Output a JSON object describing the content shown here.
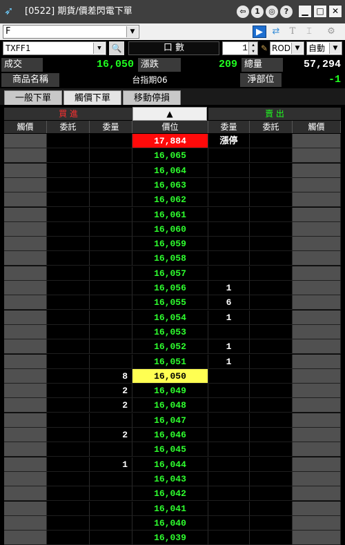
{
  "window": {
    "title": "[0522] 期貨/價差閃電下單",
    "buttons": [
      "⇦",
      "1",
      "◎",
      "?"
    ]
  },
  "toolbar": {
    "account_value": "F",
    "icons": [
      "arrow-right-icon",
      "refresh-icon",
      "font-icon",
      "bracket-icon",
      "gear-icon"
    ]
  },
  "order": {
    "symbol": "TXFF1",
    "lots_label": "口 數",
    "quantity": "1",
    "time_in_force": "ROD",
    "mode": "自動"
  },
  "quote": {
    "last_label": "成交",
    "last_value": "16,050",
    "change_label": "漲跌",
    "change_value": "209",
    "volume_label": "總量",
    "volume_value": "57,294"
  },
  "product": {
    "name_label": "商品名稱",
    "name_value": "台指期06",
    "net_label": "淨部位",
    "net_value": "-1"
  },
  "tabs": [
    "一般下單",
    "觸價下單",
    "移動停損"
  ],
  "ladder": {
    "buy_label": "買 進",
    "sell_label": "賣 出",
    "center_symbol": "▲",
    "columns": [
      "觸價",
      "委託",
      "委量",
      "價位",
      "委量",
      "委託",
      "觸價"
    ],
    "colors": {
      "buy": "#ff3030",
      "sell": "#20ff20",
      "price": "#2eff2e",
      "limit_up_bg": "#ff0a0a",
      "last_bg": "#ffff52"
    },
    "rows": [
      {
        "price": "17,884",
        "buy_qty": "",
        "sell_qty": "漲停",
        "style": "limitup"
      },
      {
        "price": "16,065",
        "buy_qty": "",
        "sell_qty": "",
        "style": ""
      },
      {
        "price": "16,064",
        "buy_qty": "",
        "sell_qty": "",
        "style": ""
      },
      {
        "price": "16,063",
        "buy_qty": "",
        "sell_qty": "",
        "style": ""
      },
      {
        "price": "16,062",
        "buy_qty": "",
        "sell_qty": "",
        "style": ""
      },
      {
        "price": "16,061",
        "buy_qty": "",
        "sell_qty": "",
        "style": ""
      },
      {
        "price": "16,060",
        "buy_qty": "",
        "sell_qty": "",
        "style": ""
      },
      {
        "price": "16,059",
        "buy_qty": "",
        "sell_qty": "",
        "style": ""
      },
      {
        "price": "16,058",
        "buy_qty": "",
        "sell_qty": "",
        "style": ""
      },
      {
        "price": "16,057",
        "buy_qty": "",
        "sell_qty": "",
        "style": ""
      },
      {
        "price": "16,056",
        "buy_qty": "",
        "sell_qty": "1",
        "style": ""
      },
      {
        "price": "16,055",
        "buy_qty": "",
        "sell_qty": "6",
        "style": ""
      },
      {
        "price": "16,054",
        "buy_qty": "",
        "sell_qty": "1",
        "style": ""
      },
      {
        "price": "16,053",
        "buy_qty": "",
        "sell_qty": "",
        "style": ""
      },
      {
        "price": "16,052",
        "buy_qty": "",
        "sell_qty": "1",
        "style": ""
      },
      {
        "price": "16,051",
        "buy_qty": "",
        "sell_qty": "1",
        "style": ""
      },
      {
        "price": "16,050",
        "buy_qty": "8",
        "sell_qty": "",
        "style": "last"
      },
      {
        "price": "16,049",
        "buy_qty": "2",
        "sell_qty": "",
        "style": ""
      },
      {
        "price": "16,048",
        "buy_qty": "2",
        "sell_qty": "",
        "style": ""
      },
      {
        "price": "16,047",
        "buy_qty": "",
        "sell_qty": "",
        "style": ""
      },
      {
        "price": "16,046",
        "buy_qty": "2",
        "sell_qty": "",
        "style": ""
      },
      {
        "price": "16,045",
        "buy_qty": "",
        "sell_qty": "",
        "style": ""
      },
      {
        "price": "16,044",
        "buy_qty": "1",
        "sell_qty": "",
        "style": ""
      },
      {
        "price": "16,043",
        "buy_qty": "",
        "sell_qty": "",
        "style": ""
      },
      {
        "price": "16,042",
        "buy_qty": "",
        "sell_qty": "",
        "style": ""
      },
      {
        "price": "16,041",
        "buy_qty": "",
        "sell_qty": "",
        "style": ""
      },
      {
        "price": "16,040",
        "buy_qty": "",
        "sell_qty": "",
        "style": ""
      },
      {
        "price": "16,039",
        "buy_qty": "",
        "sell_qty": "",
        "style": ""
      }
    ]
  }
}
